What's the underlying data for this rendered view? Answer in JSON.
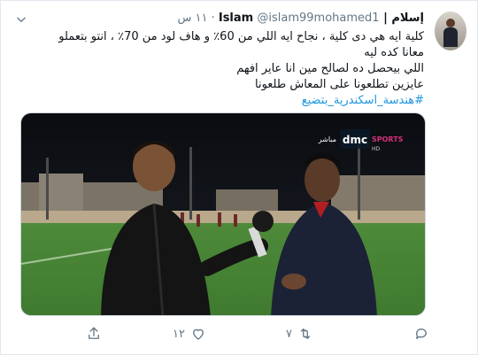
{
  "tweet": {
    "display_name": "إسلام | Islam",
    "handle": "@islam99mohamed1",
    "separator": "·",
    "time": "١١ س",
    "line1": "كلية ايه هي دى كلية ، نجاح ايه اللي من 60٪ و هاف لود من 70٪ ، انتو بتعملو",
    "line2": "معانا كده ليه",
    "line3": "اللي بيحصل ده لصالح مين انا عاير افهم",
    "line4": "عايزين تطلعونا على المعاش طلعونا",
    "hashtag": "#هندسة_اسكندرية_بتضيع"
  },
  "media": {
    "channel_logo": "dmc",
    "channel_sports": "SPORTS",
    "channel_live": "مباشر",
    "channel_hd": "HD"
  },
  "actions": {
    "reply_count": "",
    "retweet_count": "٧",
    "like_count": "١٢",
    "share_count": ""
  },
  "icons": {
    "caret": "chevron-down-icon",
    "reply": "reply-icon",
    "retweet": "retweet-icon",
    "like": "heart-icon",
    "share": "share-icon"
  },
  "colors": {
    "link": "#1b95e0",
    "muted": "#657786",
    "text": "#0f1419"
  }
}
